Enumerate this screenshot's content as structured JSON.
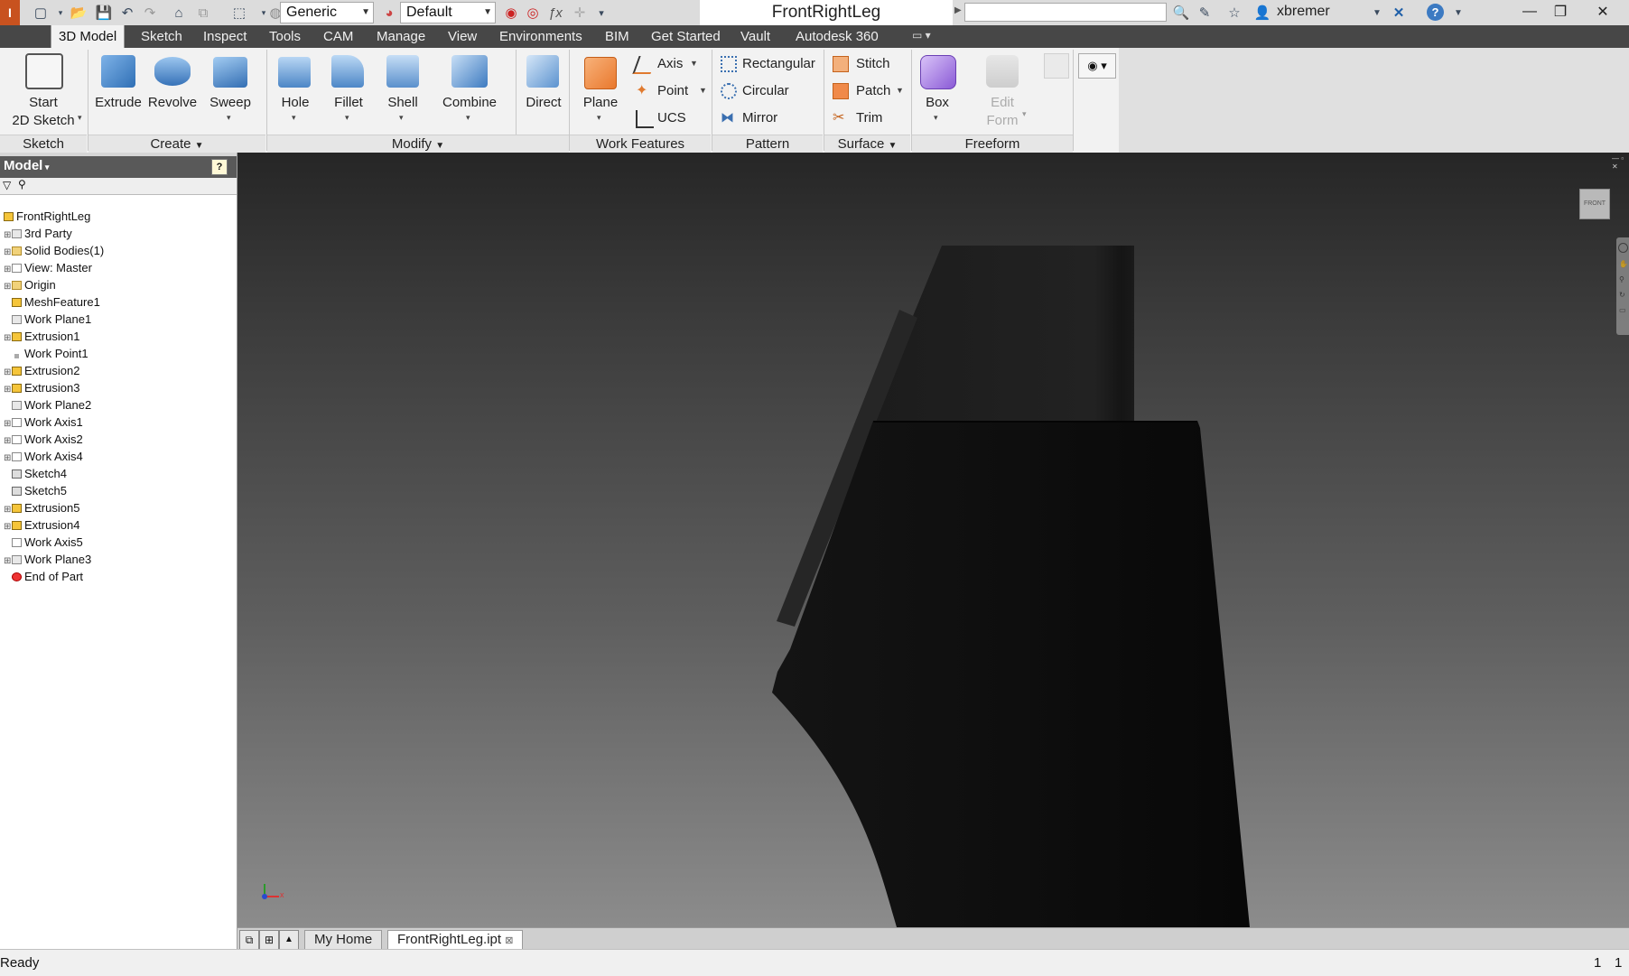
{
  "window": {
    "title": "FrontRightLeg",
    "user": "xbremer",
    "controls": [
      "minimize",
      "restore",
      "close"
    ]
  },
  "quick_access": {
    "material": "Generic",
    "appearance": "Default"
  },
  "ribbon_tabs": [
    "3D Model",
    "Sketch",
    "Inspect",
    "Tools",
    "CAM",
    "Manage",
    "View",
    "Environments",
    "BIM",
    "Get Started",
    "Vault",
    "Autodesk 360"
  ],
  "active_tab": "3D Model",
  "ribbon": {
    "sketch": {
      "start_line1": "Start",
      "start_line2": "2D Sketch",
      "panel": "Sketch"
    },
    "create": {
      "extrude": "Extrude",
      "revolve": "Revolve",
      "sweep": "Sweep",
      "panel": "Create"
    },
    "modify": {
      "hole": "Hole",
      "fillet": "Fillet",
      "shell": "Shell",
      "combine": "Combine",
      "direct": "Direct",
      "panel": "Modify"
    },
    "work_features": {
      "plane": "Plane",
      "axis": "Axis",
      "point": "Point",
      "ucs": "UCS",
      "panel": "Work Features"
    },
    "pattern": {
      "rectangular": "Rectangular",
      "circular": "Circular",
      "mirror": "Mirror",
      "panel": "Pattern"
    },
    "surface": {
      "stitch": "Stitch",
      "patch": "Patch",
      "trim": "Trim",
      "panel": "Surface"
    },
    "freeform": {
      "box": "Box",
      "edit_line1": "Edit",
      "edit_line2": "Form",
      "panel": "Freeform"
    }
  },
  "browser": {
    "title": "Model",
    "help_icon": "?",
    "items": [
      {
        "label": "FrontRightLeg",
        "icon": "part-icon"
      },
      {
        "label": "3rd Party",
        "icon": "thirdparty-icon"
      },
      {
        "label": "Solid Bodies(1)",
        "icon": "folder-icon"
      },
      {
        "label": "View: Master",
        "icon": "view-icon"
      },
      {
        "label": "Origin",
        "icon": "folder-icon"
      },
      {
        "label": "MeshFeature1",
        "icon": "mesh-icon"
      },
      {
        "label": "Work Plane1",
        "icon": "plane-icon"
      },
      {
        "label": "Extrusion1",
        "icon": "extrude-icon"
      },
      {
        "label": "Work Point1",
        "icon": "point-icon"
      },
      {
        "label": "Extrusion2",
        "icon": "extrude-icon"
      },
      {
        "label": "Extrusion3",
        "icon": "extrude-icon"
      },
      {
        "label": "Work Plane2",
        "icon": "plane-icon"
      },
      {
        "label": "Work Axis1",
        "icon": "axis-icon"
      },
      {
        "label": "Work Axis2",
        "icon": "axis-icon"
      },
      {
        "label": "Work Axis4",
        "icon": "axis-icon"
      },
      {
        "label": "Sketch4",
        "icon": "sketch-icon"
      },
      {
        "label": "Sketch5",
        "icon": "sketch-icon"
      },
      {
        "label": "Extrusion5",
        "icon": "extrude-icon"
      },
      {
        "label": "Extrusion4",
        "icon": "extrude-icon"
      },
      {
        "label": "Work Axis5",
        "icon": "axis-icon"
      },
      {
        "label": "Work Plane3",
        "icon": "plane-icon"
      },
      {
        "label": "End of Part",
        "icon": "end-icon"
      }
    ]
  },
  "viewcube": {
    "face": "FRONT"
  },
  "triad": {
    "x": "x"
  },
  "document_tabs": [
    "My Home",
    "FrontRightLeg.ipt"
  ],
  "active_document": "FrontRightLeg.ipt",
  "status": {
    "text": "Ready",
    "count_a": "1",
    "count_b": "1"
  }
}
